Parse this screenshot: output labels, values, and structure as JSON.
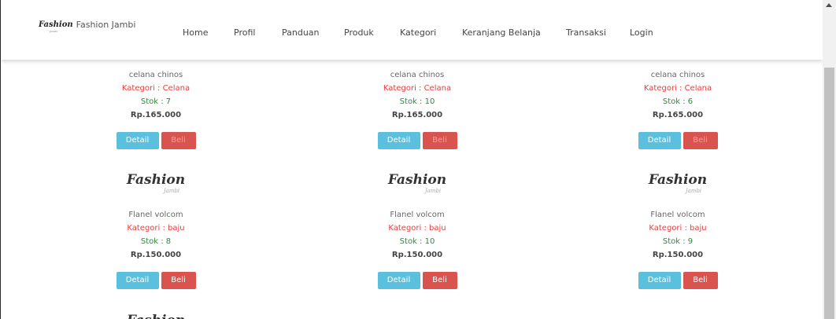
{
  "brand": {
    "logo_text": "Fashion",
    "logo_sub": "Jambi",
    "name": "Fashion Jambi"
  },
  "nav": [
    "Home",
    "Profil",
    "Panduan",
    "Produk",
    "Kategori",
    "Keranjang Belanja",
    "Transaksi",
    "Login"
  ],
  "product_logo": {
    "main": "Fashion",
    "sub": "Jambi"
  },
  "buttons": {
    "detail": "Detail",
    "beli": "Beli"
  },
  "columns": [
    {
      "row1": {
        "name": "celana chinos",
        "kategori": "Kategori : Celana",
        "stok": "Stok : 7",
        "price": "Rp.165.000"
      },
      "row2": {
        "name": "Flanel volcom",
        "kategori": "Kategori : baju",
        "stok": "Stok : 8",
        "price": "Rp.150.000"
      }
    },
    {
      "row1": {
        "name": "celana chinos",
        "kategori": "Kategori : Celana",
        "stok": "Stok : 10",
        "price": "Rp.165.000"
      },
      "row2": {
        "name": "Flanel volcom",
        "kategori": "Kategori : baju",
        "stok": "Stok : 10",
        "price": "Rp.150.000"
      }
    },
    {
      "row1": {
        "name": "celana chinos",
        "kategori": "Kategori : Celana",
        "stok": "Stok : 6",
        "price": "Rp.165.000"
      },
      "row2": {
        "name": "Flanel volcom",
        "kategori": "Kategori : baju",
        "stok": "Stok : 9",
        "price": "Rp.150.000"
      }
    }
  ]
}
